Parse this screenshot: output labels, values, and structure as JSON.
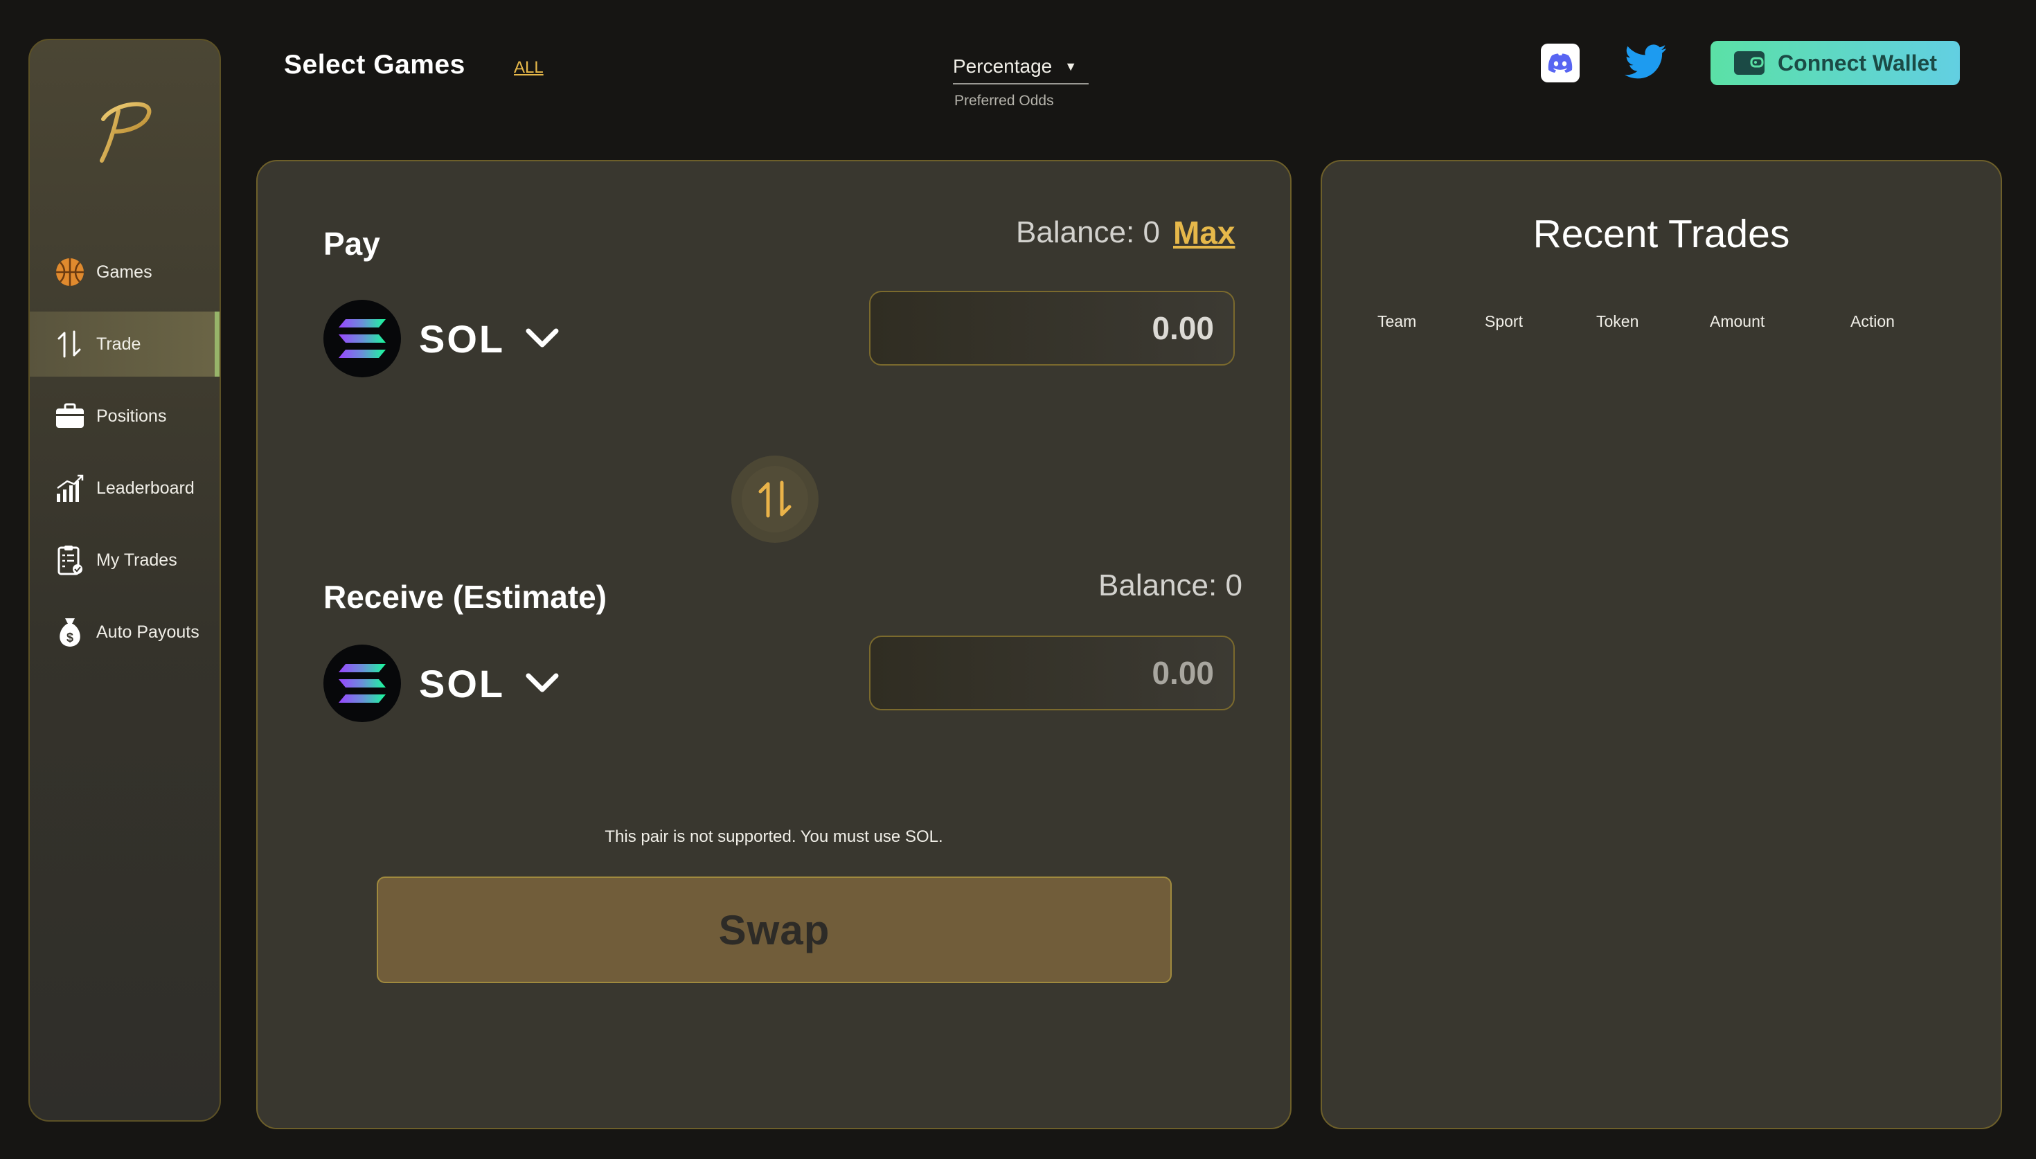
{
  "sidebar": {
    "logo_letter": "P",
    "items": [
      {
        "label": "Games",
        "icon": "basketball-icon",
        "active": false
      },
      {
        "label": "Trade",
        "icon": "trade-arrows-icon",
        "active": true
      },
      {
        "label": "Positions",
        "icon": "briefcase-icon",
        "active": false
      },
      {
        "label": "Leaderboard",
        "icon": "bar-chart-icon",
        "active": false
      },
      {
        "label": "My Trades",
        "icon": "clipboard-icon",
        "active": false
      },
      {
        "label": "Auto Payouts",
        "icon": "money-bag-icon",
        "active": false
      }
    ]
  },
  "header": {
    "title": "Select Games",
    "all_link": "ALL",
    "odds_value": "Percentage",
    "odds_caption": "Preferred Odds",
    "connect_label": "Connect Wallet"
  },
  "trade": {
    "pay_label": "Pay",
    "pay_balance": "Balance: 0",
    "max_label": "Max",
    "pay_token": "SOL",
    "pay_amount_placeholder": "0.00",
    "receive_label": "Receive (Estimate)",
    "receive_balance": "Balance: 0",
    "receive_token": "SOL",
    "receive_amount_placeholder": "0.00",
    "notice": "This pair is not supported. You must use SOL.",
    "swap_label": "Swap"
  },
  "recent_trades": {
    "title": "Recent Trades",
    "columns": [
      "Team",
      "Sport",
      "Token",
      "Amount",
      "Action"
    ],
    "rows": []
  },
  "colors": {
    "background": "#161513",
    "panel": "#39372f",
    "accent_gold": "#e6b84a",
    "active_bar": "#97b46a",
    "wallet_gradient_start": "#5be1a6",
    "wallet_gradient_end": "#62cfe2"
  }
}
